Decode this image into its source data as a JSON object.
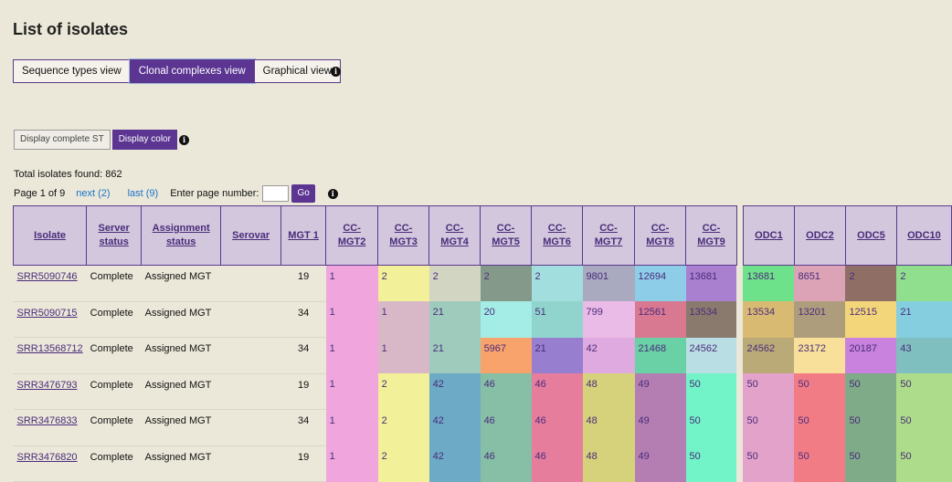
{
  "page_title": "List of isolates",
  "views": [
    {
      "label": "Sequence types view",
      "active": false
    },
    {
      "label": "Clonal complexes view",
      "active": true
    },
    {
      "label": "Graphical view",
      "active": false
    }
  ],
  "display": {
    "complete_label": "Display complete ST",
    "color_label": "Display color"
  },
  "total_text": "Total isolates found: 862",
  "pager": {
    "page_text": "Page 1 of 9",
    "next_label": "next (2)",
    "last_label": "last (9)",
    "enter_label": "Enter page number:",
    "go_label": "Go"
  },
  "info_glyph": "i",
  "table": {
    "headers": [
      "Isolate",
      "Server status",
      "Assignment status",
      "Serovar",
      "MGT 1",
      "CC-MGT2",
      "CC-MGT3",
      "CC-MGT4",
      "CC-MGT5",
      "CC-MGT6",
      "CC-MGT7",
      "CC-MGT8",
      "CC-MGT9",
      "ODC1",
      "ODC2",
      "ODC5",
      "ODC10"
    ],
    "rows": [
      {
        "isolate": "SRR5090746",
        "server": "Complete",
        "assign": "Assigned MGT",
        "serovar": "",
        "mgt1": "19",
        "cc": [
          "1",
          "2",
          "2",
          "2",
          "2",
          "9801",
          "12694",
          "13681"
        ],
        "odc": [
          "13681",
          "8651",
          "2",
          "2"
        ],
        "cc_colors": [
          "#f0a6dc",
          "#f2f099",
          "#d3d5c3",
          "#85998a",
          "#a3dede",
          "#a9a9c0",
          "#8ecde7",
          "#a97fd0"
        ],
        "odc_colors": [
          "#6ee28a",
          "#dba3b5",
          "#8f6e66",
          "#8fdf8f"
        ]
      },
      {
        "isolate": "SRR5090715",
        "server": "Complete",
        "assign": "Assigned MGT",
        "serovar": "",
        "mgt1": "34",
        "cc": [
          "1",
          "1",
          "21",
          "20",
          "51",
          "799",
          "12561",
          "13534"
        ],
        "odc": [
          "13534",
          "13201",
          "12515",
          "21"
        ],
        "cc_colors": [
          "#f0a6dc",
          "#d8b8c6",
          "#9ecbbb",
          "#a4ece6",
          "#90d4cd",
          "#ebbbe8",
          "#d97891",
          "#8a7a6e"
        ],
        "odc_colors": [
          "#d9ba72",
          "#ae9d7c",
          "#f4d67a",
          "#84cee0"
        ]
      },
      {
        "isolate": "SRR13568712",
        "server": "Complete",
        "assign": "Assigned MGT",
        "serovar": "",
        "mgt1": "34",
        "cc": [
          "1",
          "1",
          "21",
          "5967",
          "21",
          "42",
          "21468",
          "24562"
        ],
        "odc": [
          "24562",
          "23172",
          "20187",
          "43"
        ],
        "cc_colors": [
          "#f0a6dc",
          "#d8b8c6",
          "#9ecbbb",
          "#f8a26c",
          "#977ece",
          "#deaadf",
          "#6ad0a5",
          "#b9dee4"
        ],
        "odc_colors": [
          "#baaa77",
          "#f8e09a",
          "#c982dd",
          "#7fbfbf"
        ]
      },
      {
        "isolate": "SRR3476793",
        "server": "Complete",
        "assign": "Assigned MGT",
        "serovar": "",
        "mgt1": "19",
        "cc": [
          "1",
          "2",
          "42",
          "46",
          "46",
          "48",
          "49",
          "50"
        ],
        "odc": [
          "50",
          "50",
          "50",
          "50"
        ],
        "cc_colors": [
          "#f0a6dc",
          "#f2f099",
          "#6caac6",
          "#87bea6",
          "#e67d9d",
          "#d6d27c",
          "#b47eb3",
          "#72f4c8"
        ],
        "odc_colors": [
          "#e2a2ca",
          "#f27c86",
          "#7fab88",
          "#addd8a"
        ]
      },
      {
        "isolate": "SRR3476833",
        "server": "Complete",
        "assign": "Assigned MGT",
        "serovar": "",
        "mgt1": "34",
        "cc": [
          "1",
          "2",
          "42",
          "46",
          "46",
          "48",
          "49",
          "50"
        ],
        "odc": [
          "50",
          "50",
          "50",
          "50"
        ],
        "cc_colors": [
          "#f0a6dc",
          "#f2f099",
          "#6caac6",
          "#87bea6",
          "#e67d9d",
          "#d6d27c",
          "#b47eb3",
          "#72f4c8"
        ],
        "odc_colors": [
          "#e2a2ca",
          "#f27c86",
          "#7fab88",
          "#addd8a"
        ]
      },
      {
        "isolate": "SRR3476820",
        "server": "Complete",
        "assign": "Assigned MGT",
        "serovar": "",
        "mgt1": "19",
        "cc": [
          "1",
          "2",
          "42",
          "46",
          "46",
          "48",
          "49",
          "50"
        ],
        "odc": [
          "50",
          "50",
          "50",
          "50"
        ],
        "cc_colors": [
          "#f0a6dc",
          "#f2f099",
          "#6caac6",
          "#87bea6",
          "#e67d9d",
          "#d6d27c",
          "#b47eb3",
          "#72f4c8"
        ],
        "odc_colors": [
          "#e2a2ca",
          "#f27c86",
          "#7fab88",
          "#addd8a"
        ]
      }
    ]
  }
}
